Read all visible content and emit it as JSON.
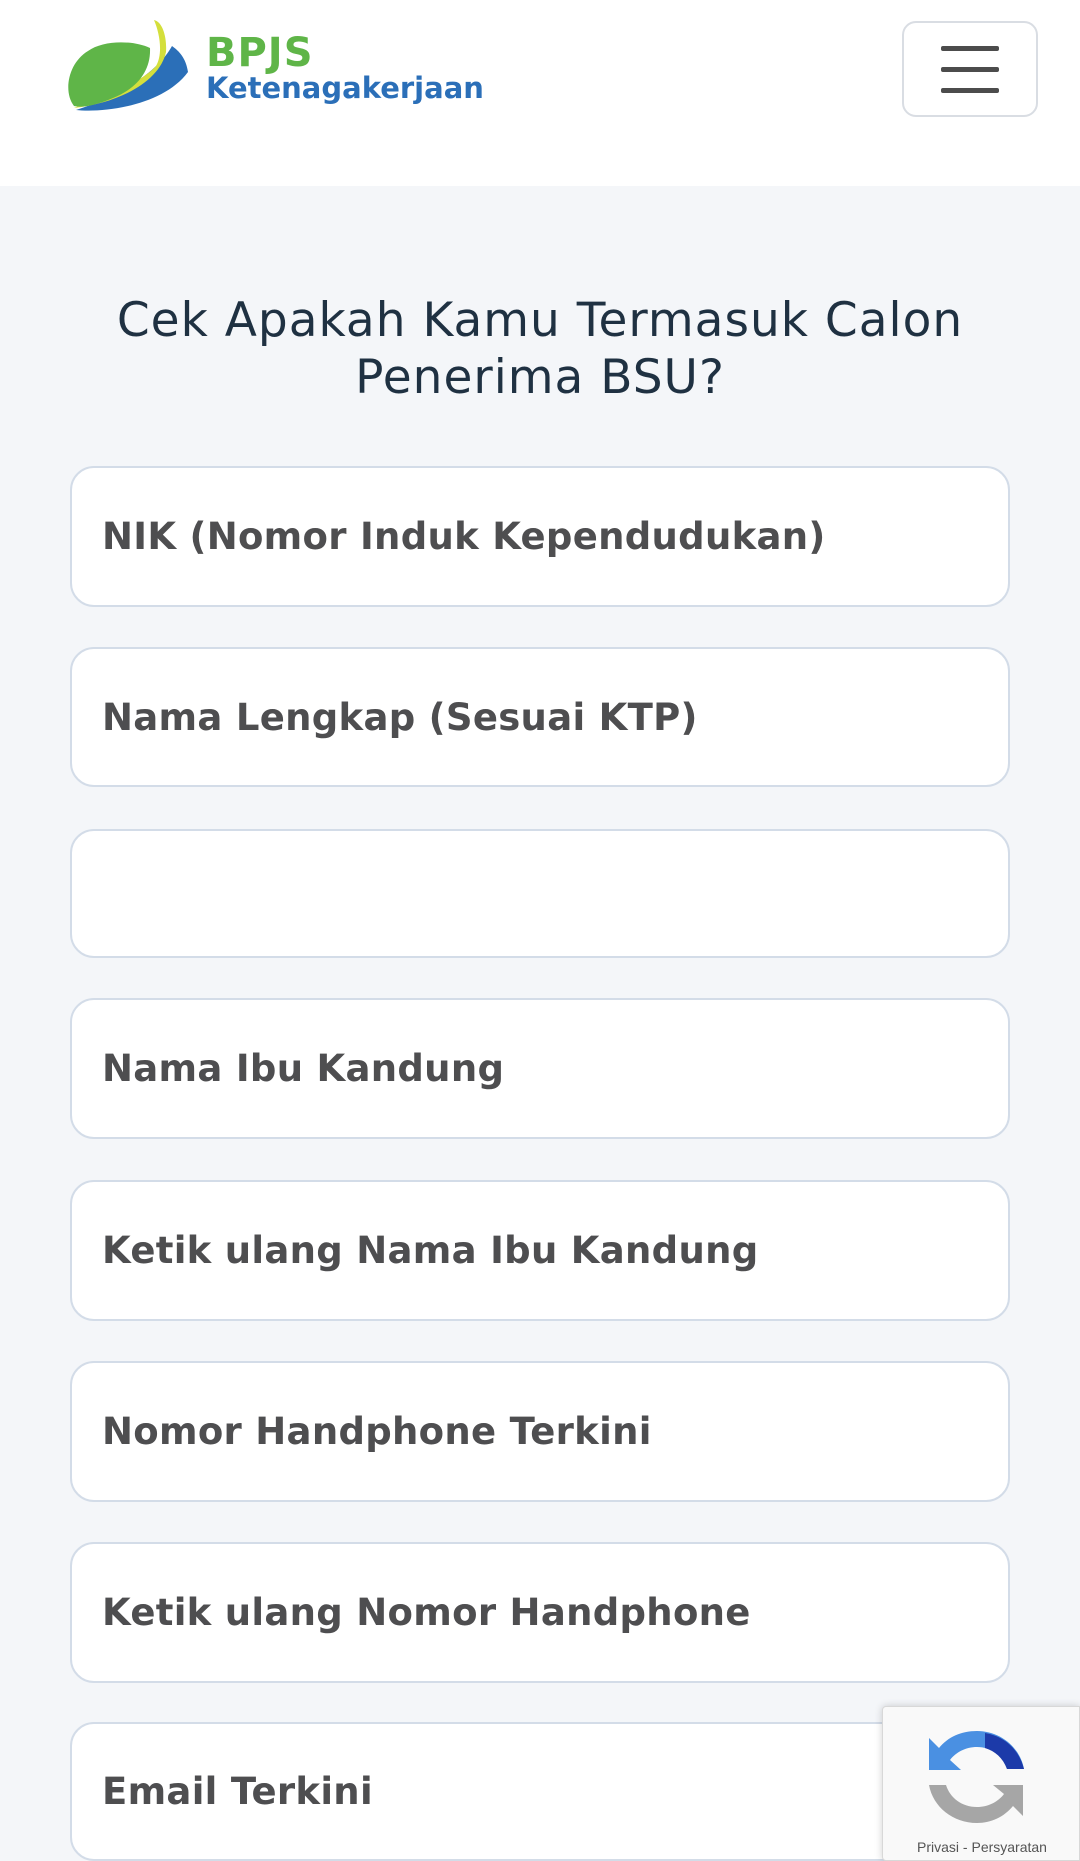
{
  "header": {
    "logo_title": "BPJS",
    "logo_subtitle": "Ketenagakerjaan",
    "menu_icon": "hamburger-menu-icon"
  },
  "page": {
    "title_line1": "Cek Apakah Kamu Termasuk Calon",
    "title_line2": "Penerima BSU?"
  },
  "form": {
    "fields": [
      {
        "placeholder": "NIK (Nomor Induk Kependudukan)",
        "value": ""
      },
      {
        "placeholder": "Nama Lengkap (Sesuai KTP)",
        "value": ""
      },
      {
        "placeholder": "",
        "value": ""
      },
      {
        "placeholder": "Nama Ibu Kandung",
        "value": ""
      },
      {
        "placeholder": "Ketik ulang Nama Ibu Kandung",
        "value": ""
      },
      {
        "placeholder": "Nomor Handphone Terkini",
        "value": ""
      },
      {
        "placeholder": "Ketik ulang Nomor Handphone",
        "value": ""
      },
      {
        "placeholder": "Email Terkini",
        "value": ""
      }
    ]
  },
  "recaptcha": {
    "icon": "recaptcha-icon",
    "privacy_label": "Privasi",
    "separator": "-",
    "terms_label": "Persyaratan"
  },
  "colors": {
    "brand_green": "#5fb548",
    "brand_blue": "#2b6fb8",
    "background": "#f4f6f9",
    "field_border": "#d3dce8",
    "text_dark": "#1f3142"
  }
}
